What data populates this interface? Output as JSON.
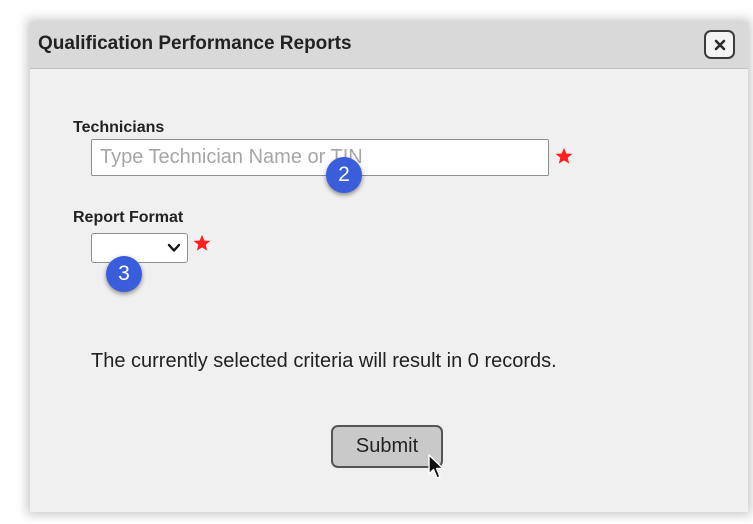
{
  "dialog": {
    "title": "Qualification Performance Reports",
    "close_icon": "close-x-icon"
  },
  "form": {
    "technicians": {
      "label": "Technicians",
      "placeholder": "Type Technician Name or TIN",
      "value": "",
      "required": true
    },
    "report_format": {
      "label": "Report Format",
      "selected": "",
      "required": true
    },
    "result_message": "The currently selected criteria will result in 0 records.",
    "submit_label": "Submit"
  },
  "annotations": {
    "step_2": "2",
    "step_3": "3"
  },
  "colors": {
    "required_star": "#ff1f1f",
    "badge": "#3a5ddb",
    "titlebar": "#d9d9d9",
    "dialog_bg": "#f0f0f0",
    "submit_bg": "#c9c9c9"
  }
}
